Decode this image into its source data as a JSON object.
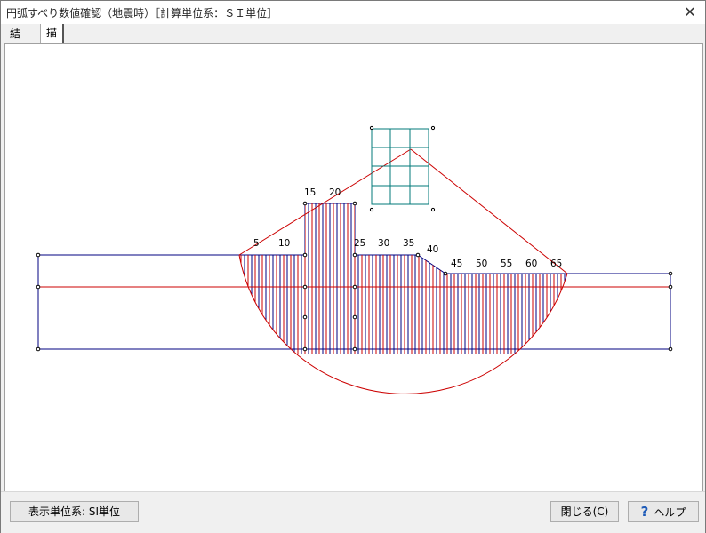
{
  "window": {
    "title": "円弧すべり数値確認（地震時）［計算単位系：ＳＩ単位］",
    "close_glyph": "✕"
  },
  "tabs": [
    {
      "label": "結果"
    },
    {
      "label": "描画"
    }
  ],
  "drawing": {
    "slice_labels": [
      "5",
      "10",
      "15",
      "20",
      "25",
      "30",
      "35",
      "40",
      "45",
      "50",
      "55",
      "60",
      "65"
    ],
    "colors": {
      "ground": "#000080",
      "hatch_red": "#cc0000",
      "hatch_blue": "#000080",
      "grid": "#007a7a",
      "lines": "#cc0000"
    }
  },
  "footer": {
    "units_button": "表示単位系: SI単位",
    "close_button": "閉じる(C)",
    "help_button": "ヘルプ",
    "help_icon": "?"
  }
}
